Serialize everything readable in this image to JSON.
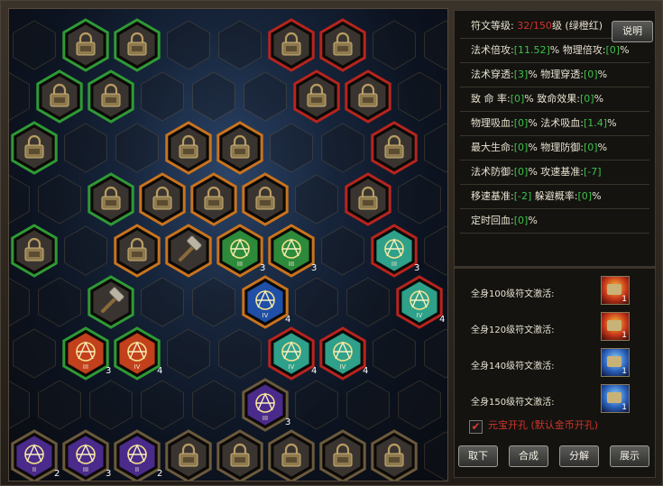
{
  "panel": {
    "explain_label": "说明",
    "level_row": {
      "label": "符文等级:",
      "current": "32",
      "sep": "/",
      "max": "150",
      "suffix": "级 (绿橙红)"
    },
    "stats": [
      [
        {
          "label": "法术倍攻:",
          "value": "[11.52]",
          "unit": "%"
        },
        {
          "label": "物理倍攻:",
          "value": "[0]",
          "unit": "%"
        }
      ],
      [
        {
          "label": "法术穿透:",
          "value": "[3]",
          "unit": "%"
        },
        {
          "label": "物理穿透:",
          "value": "[0]",
          "unit": "%"
        }
      ],
      [
        {
          "label": "致 命 率:",
          "value": "[0]",
          "unit": "%"
        },
        {
          "label": "致命效果:",
          "value": "[0]",
          "unit": "%"
        }
      ],
      [
        {
          "label": "物理吸血:",
          "value": "[0]",
          "unit": "%"
        },
        {
          "label": "法术吸血:",
          "value": "[1.4]",
          "unit": "%"
        }
      ],
      [
        {
          "label": "最大生命:",
          "value": "[0]",
          "unit": "%"
        },
        {
          "label": "物理防御:",
          "value": "[0]",
          "unit": "%"
        }
      ],
      [
        {
          "label": "法术防御:",
          "value": "[0]",
          "unit": "%"
        },
        {
          "label": "攻速基准:",
          "value": "[-7]",
          "unit": ""
        }
      ],
      [
        {
          "label": "移速基准:",
          "value": "[-2]",
          "unit": ""
        },
        {
          "label": "躲避概率:",
          "value": "[0]",
          "unit": "%"
        }
      ],
      [
        {
          "label": "定时回血:",
          "value": "[0]",
          "unit": "%"
        }
      ]
    ],
    "activations": [
      {
        "label": "全身100级符文激活:",
        "icon": "fire-rune-icon",
        "count": "1"
      },
      {
        "label": "全身120级符文激活:",
        "icon": "fire-rune-icon",
        "count": "1"
      },
      {
        "label": "全身140级符文激活:",
        "icon": "ice-rune-icon",
        "count": "1"
      },
      {
        "label": "全身150级符文激活:",
        "icon": "ice-rune-icon",
        "count": "1"
      }
    ],
    "gold_socket": {
      "label": "元宝开孔",
      "note": "(默认金币开孔)",
      "checked": true
    },
    "buttons": {
      "remove": "取下",
      "combine": "合成",
      "decompose": "分解",
      "display": "展示"
    }
  },
  "board": {
    "colors": {
      "green": "#2f9a36",
      "red": "#b8241e",
      "orange": "#c9731e",
      "gray": "#6b5a3c",
      "blue": "#2a5db8"
    },
    "cells": [
      {
        "col": 1,
        "row": 0,
        "frame": "green",
        "content": "lock",
        "icon": "lock-icon"
      },
      {
        "col": 2,
        "row": 0,
        "frame": "green",
        "content": "lock",
        "icon": "lock-icon"
      },
      {
        "col": 5,
        "row": 0,
        "frame": "red",
        "content": "lock",
        "icon": "lock-icon"
      },
      {
        "col": 6,
        "row": 0,
        "frame": "red",
        "content": "lock",
        "icon": "lock-icon"
      },
      {
        "col": 0,
        "row": 1,
        "frame": "green",
        "content": "lock",
        "icon": "lock-icon"
      },
      {
        "col": 1,
        "row": 1,
        "frame": "green",
        "content": "lock",
        "icon": "lock-icon"
      },
      {
        "col": 5,
        "row": 1,
        "frame": "red",
        "content": "lock",
        "icon": "lock-icon"
      },
      {
        "col": 6,
        "row": 1,
        "frame": "red",
        "content": "lock",
        "icon": "lock-icon"
      },
      {
        "col": 0,
        "row": 2,
        "frame": "green",
        "content": "lock",
        "icon": "lock-icon"
      },
      {
        "col": 3,
        "row": 2,
        "frame": "orange",
        "content": "lock",
        "icon": "lock-icon"
      },
      {
        "col": 4,
        "row": 2,
        "frame": "orange",
        "content": "lock",
        "icon": "lock-icon"
      },
      {
        "col": 7,
        "row": 2,
        "frame": "red",
        "content": "lock",
        "icon": "lock-icon"
      },
      {
        "col": 1,
        "row": 3,
        "frame": "green",
        "content": "lock",
        "icon": "lock-icon"
      },
      {
        "col": 2,
        "row": 3,
        "frame": "orange",
        "content": "lock",
        "icon": "lock-icon"
      },
      {
        "col": 3,
        "row": 3,
        "frame": "orange",
        "content": "lock",
        "icon": "lock-icon"
      },
      {
        "col": 4,
        "row": 3,
        "frame": "orange",
        "content": "lock",
        "icon": "lock-icon"
      },
      {
        "col": 6,
        "row": 3,
        "frame": "red",
        "content": "lock",
        "icon": "lock-icon"
      },
      {
        "col": 0,
        "row": 4,
        "frame": "green",
        "content": "lock",
        "icon": "lock-icon"
      },
      {
        "col": 2,
        "row": 4,
        "frame": "orange",
        "content": "lock",
        "icon": "lock-icon"
      },
      {
        "col": 3,
        "row": 4,
        "frame": "orange",
        "content": "hammer",
        "icon": "hammer-icon"
      },
      {
        "col": 4,
        "row": 4,
        "frame": "orange",
        "content": "rune",
        "fill": "green",
        "level": "III",
        "count": "3",
        "icon": "rune-icon"
      },
      {
        "col": 5,
        "row": 4,
        "frame": "orange",
        "content": "rune",
        "fill": "green",
        "level": "III",
        "count": "3",
        "icon": "rune-icon"
      },
      {
        "col": 7,
        "row": 4,
        "frame": "red",
        "content": "rune",
        "fill": "teal",
        "level": "III",
        "count": "3",
        "icon": "rune-icon"
      },
      {
        "col": 1,
        "row": 5,
        "frame": "green",
        "content": "hammer",
        "icon": "hammer-icon"
      },
      {
        "col": 4,
        "row": 5,
        "frame": "orange",
        "content": "rune",
        "fill": "blue",
        "level": "IV",
        "count": "4",
        "icon": "rune-icon"
      },
      {
        "col": 7,
        "row": 5,
        "frame": "red",
        "content": "rune",
        "fill": "teal",
        "level": "IV",
        "count": "4",
        "icon": "rune-icon"
      },
      {
        "col": 1,
        "row": 6,
        "frame": "green",
        "content": "rune",
        "fill": "red",
        "level": "III",
        "count": "3",
        "icon": "rune-icon"
      },
      {
        "col": 2,
        "row": 6,
        "frame": "green",
        "content": "rune",
        "fill": "red",
        "level": "IV",
        "count": "4",
        "icon": "rune-icon"
      },
      {
        "col": 5,
        "row": 6,
        "frame": "red",
        "content": "rune",
        "fill": "teal",
        "level": "IV",
        "count": "4",
        "icon": "rune-icon"
      },
      {
        "col": 6,
        "row": 6,
        "frame": "red",
        "content": "rune",
        "fill": "teal",
        "level": "IV",
        "count": "4",
        "icon": "rune-icon"
      },
      {
        "col": 4,
        "row": 7,
        "frame": "gray",
        "content": "rune",
        "fill": "purple",
        "level": "III",
        "count": "3",
        "icon": "rune-icon"
      },
      {
        "col": 0,
        "row": 8,
        "frame": "gray",
        "content": "rune",
        "fill": "purple",
        "level": "II",
        "count": "2",
        "icon": "rune-icon"
      },
      {
        "col": 1,
        "row": 8,
        "frame": "gray",
        "content": "rune",
        "fill": "purple",
        "level": "III",
        "count": "3",
        "icon": "rune-icon"
      },
      {
        "col": 2,
        "row": 8,
        "frame": "gray",
        "content": "rune",
        "fill": "purple",
        "level": "II",
        "count": "2",
        "icon": "rune-icon"
      },
      {
        "col": 3,
        "row": 8,
        "frame": "gray",
        "content": "lock",
        "icon": "lock-icon"
      },
      {
        "col": 4,
        "row": 8,
        "frame": "gray",
        "content": "lock",
        "icon": "lock-icon"
      },
      {
        "col": 5,
        "row": 8,
        "frame": "gray",
        "content": "lock",
        "icon": "lock-icon"
      },
      {
        "col": 6,
        "row": 8,
        "frame": "gray",
        "content": "lock",
        "icon": "lock-icon"
      },
      {
        "col": 7,
        "row": 8,
        "frame": "gray",
        "content": "lock",
        "icon": "lock-icon"
      }
    ]
  }
}
